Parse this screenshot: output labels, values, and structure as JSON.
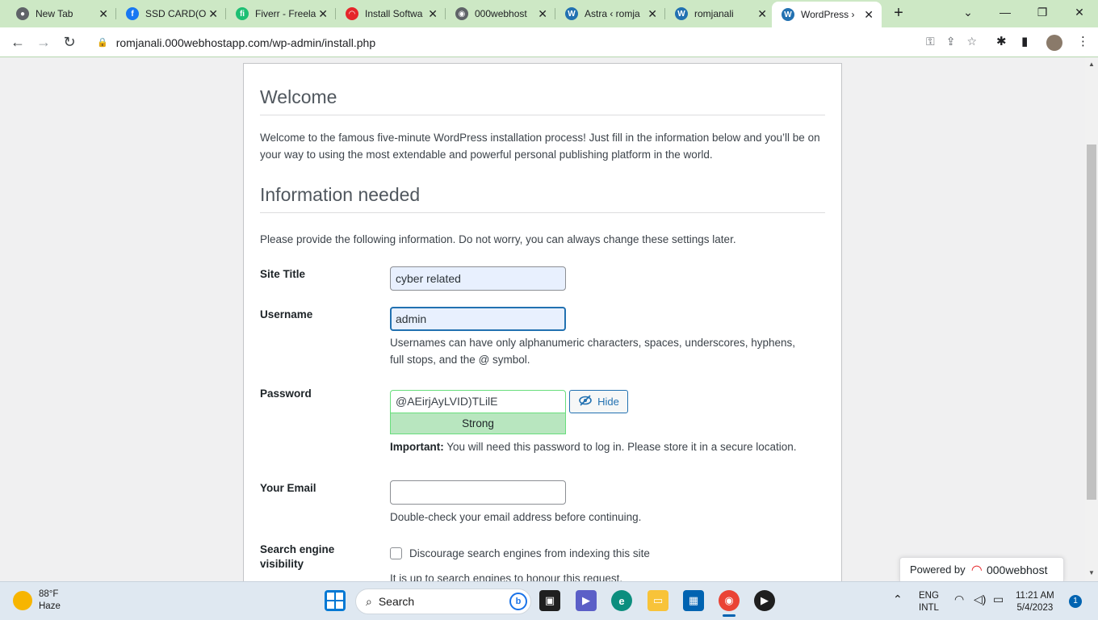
{
  "browser": {
    "tabs": [
      {
        "label": "New Tab",
        "icon": "chrome-icon",
        "color": "#5f6368",
        "glyph": "●"
      },
      {
        "label": "SSD CARD(O",
        "icon": "facebook-icon",
        "color": "#1877f2",
        "glyph": "f"
      },
      {
        "label": "Fiverr - Freela",
        "icon": "fiverr-icon",
        "color": "#1dbf73",
        "glyph": "fi"
      },
      {
        "label": "Install Softwa",
        "icon": "webhost-icon",
        "color": "#e5262a",
        "glyph": "◠"
      },
      {
        "label": "000webhost",
        "icon": "globe-icon",
        "color": "#5f6368",
        "glyph": "◉"
      },
      {
        "label": "Astra ‹ romja",
        "icon": "wordpress-icon",
        "color": "#2271b1",
        "glyph": "W"
      },
      {
        "label": "romjanali",
        "icon": "wordpress-icon",
        "color": "#2271b1",
        "glyph": "W"
      },
      {
        "label": "WordPress ›",
        "icon": "wordpress-icon",
        "color": "#2271b1",
        "glyph": "W"
      }
    ],
    "new_tab": "+",
    "url": "romjanali.000webhostapp.com/wp-admin/install.php"
  },
  "page": {
    "welcome_heading": "Welcome",
    "welcome_text": "Welcome to the famous five-minute WordPress installation process! Just fill in the information below and you’ll be on your way to using the most extendable and powerful personal publishing platform in the world.",
    "info_heading": "Information needed",
    "info_text": "Please provide the following information. Do not worry, you can always change these settings later.",
    "site_title_label": "Site Title",
    "site_title_value": "cyber related",
    "username_label": "Username",
    "username_value": "admin",
    "username_desc": "Usernames can have only alphanumeric characters, spaces, underscores, hyphens, full stops, and the @ symbol.",
    "password_label": "Password",
    "password_value": "@AEirjAyLVID)TLilE",
    "password_strength": "Strong",
    "hide_label": "Hide",
    "important_label": "Important:",
    "important_text": " You will need this password to log in. Please store it in a secure location.",
    "email_label": "Your Email",
    "email_value": "",
    "email_desc": "Double-check your email address before continuing.",
    "search_label_1": "Search engine",
    "search_label_2": "visibility",
    "search_checkbox_label": "Discourage search engines from indexing this site",
    "search_desc": "It is up to search engines to honour this request."
  },
  "powered": {
    "label": "Powered by",
    "brand": "000webhost"
  },
  "taskbar": {
    "weather_temp": "88°F",
    "weather_cond": "Haze",
    "search_placeholder": "Search",
    "lang_1": "ENG",
    "lang_2": "INTL",
    "time": "11:21 AM",
    "date": "5/4/2023",
    "notifications": "1"
  },
  "colors": {
    "tabstrip": "#cde8c5",
    "wp_blue": "#2271b1",
    "strength_green": "#b8e6bf"
  }
}
